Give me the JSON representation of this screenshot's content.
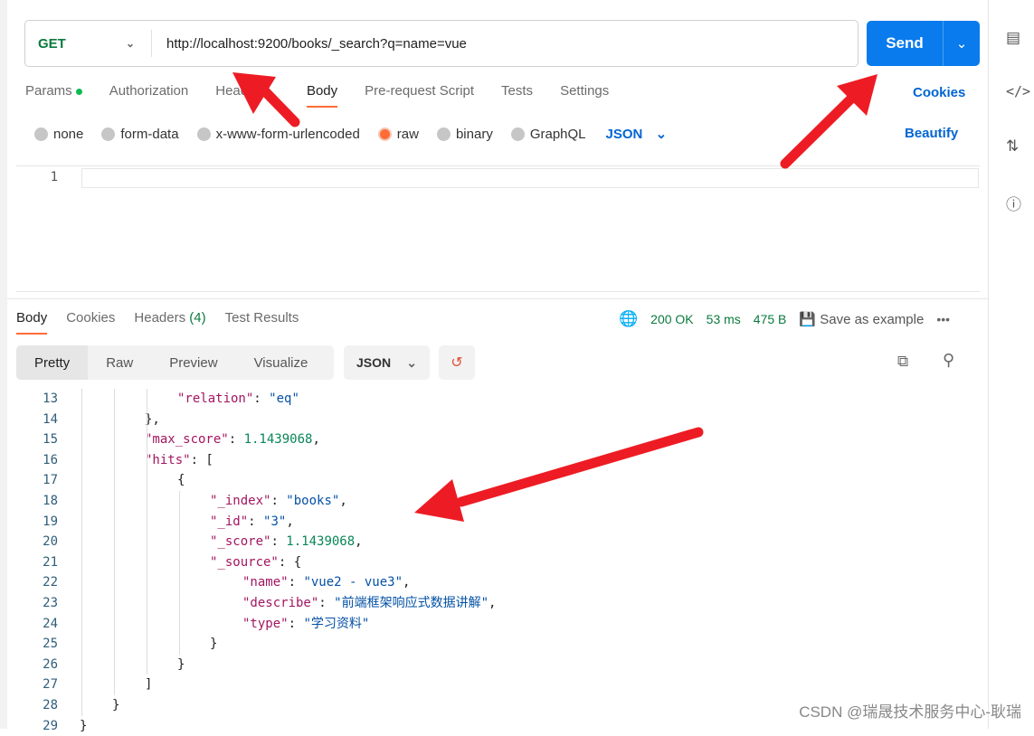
{
  "request": {
    "method": "GET",
    "url": "http://localhost:9200/books/_search?q=name=vue",
    "send_label": "Send"
  },
  "request_tabs": [
    "Params",
    "Authorization",
    "Headers",
    "Body",
    "Pre-request Script",
    "Tests",
    "Settings"
  ],
  "cookies_label": "Cookies",
  "body_types": [
    "none",
    "form-data",
    "x-www-form-urlencoded",
    "raw",
    "binary",
    "GraphQL"
  ],
  "body_format": "JSON",
  "beautify_label": "Beautify",
  "editor_line": "1",
  "response_tabs": [
    "Body",
    "Cookies",
    "Headers",
    "(4)",
    "Test Results"
  ],
  "response_status": {
    "status": "200 OK",
    "time": "53 ms",
    "size": "475 B",
    "save_label": "Save as example"
  },
  "view_modes": [
    "Pretty",
    "Raw",
    "Preview",
    "Visualize"
  ],
  "response_format": "JSON",
  "code_lines": [
    {
      "n": "13",
      "indent": 3,
      "parts": [
        [
          "k",
          "\"relation\""
        ],
        [
          "p",
          ": "
        ],
        [
          "s",
          "\"eq\""
        ]
      ]
    },
    {
      "n": "14",
      "indent": 2,
      "parts": [
        [
          "p",
          "},"
        ]
      ]
    },
    {
      "n": "15",
      "indent": 2,
      "parts": [
        [
          "k",
          "\"max_score\""
        ],
        [
          "p",
          ": "
        ],
        [
          "n",
          "1.1439068"
        ],
        [
          "p",
          ","
        ]
      ]
    },
    {
      "n": "16",
      "indent": 2,
      "parts": [
        [
          "k",
          "\"hits\""
        ],
        [
          "p",
          ": ["
        ]
      ]
    },
    {
      "n": "17",
      "indent": 3,
      "parts": [
        [
          "p",
          "{"
        ]
      ]
    },
    {
      "n": "18",
      "indent": 4,
      "parts": [
        [
          "k",
          "\"_index\""
        ],
        [
          "p",
          ": "
        ],
        [
          "s",
          "\"books\""
        ],
        [
          "p",
          ","
        ]
      ]
    },
    {
      "n": "19",
      "indent": 4,
      "parts": [
        [
          "k",
          "\"_id\""
        ],
        [
          "p",
          ": "
        ],
        [
          "s",
          "\"3\""
        ],
        [
          "p",
          ","
        ]
      ]
    },
    {
      "n": "20",
      "indent": 4,
      "parts": [
        [
          "k",
          "\"_score\""
        ],
        [
          "p",
          ": "
        ],
        [
          "n",
          "1.1439068"
        ],
        [
          "p",
          ","
        ]
      ]
    },
    {
      "n": "21",
      "indent": 4,
      "parts": [
        [
          "k",
          "\"_source\""
        ],
        [
          "p",
          ": {"
        ]
      ]
    },
    {
      "n": "22",
      "indent": 5,
      "parts": [
        [
          "k",
          "\"name\""
        ],
        [
          "p",
          ": "
        ],
        [
          "s",
          "\"vue2 - vue3\""
        ],
        [
          "p",
          ","
        ]
      ]
    },
    {
      "n": "23",
      "indent": 5,
      "parts": [
        [
          "k",
          "\"describe\""
        ],
        [
          "p",
          ": "
        ],
        [
          "s",
          "\"前端框架响应式数据讲解\""
        ],
        [
          "p",
          ","
        ]
      ]
    },
    {
      "n": "24",
      "indent": 5,
      "parts": [
        [
          "k",
          "\"type\""
        ],
        [
          "p",
          ": "
        ],
        [
          "s",
          "\"学习资料\""
        ]
      ]
    },
    {
      "n": "25",
      "indent": 4,
      "parts": [
        [
          "p",
          "}"
        ]
      ]
    },
    {
      "n": "26",
      "indent": 3,
      "parts": [
        [
          "p",
          "}"
        ]
      ]
    },
    {
      "n": "27",
      "indent": 2,
      "parts": [
        [
          "p",
          "]"
        ]
      ]
    },
    {
      "n": "28",
      "indent": 1,
      "parts": [
        [
          "p",
          "}"
        ]
      ]
    },
    {
      "n": "29",
      "indent": 0,
      "parts": [
        [
          "p",
          "}"
        ]
      ]
    }
  ],
  "watermark": "CSDN @瑞晟技术服务中心-耿瑞",
  "colors": {
    "accent": "#ff6c37",
    "send": "#097bed",
    "status_green": "#0b7a3e",
    "arrow": "#ed1c24"
  }
}
